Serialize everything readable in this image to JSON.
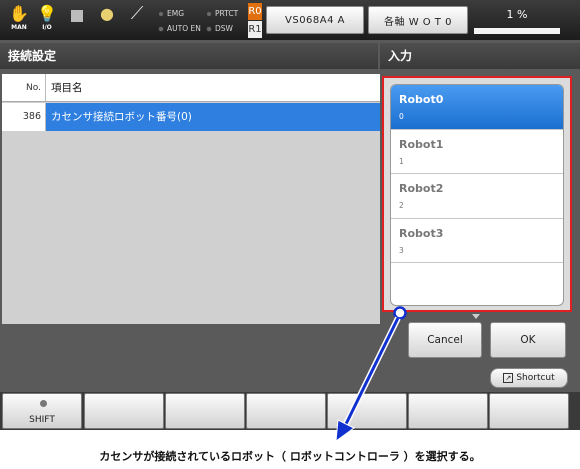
{
  "topbar": {
    "mode_caption": "MAN",
    "io_caption": "I/O",
    "leds": {
      "emg": "EMG",
      "prtct": "PRTCT",
      "auto_en": "AUTO EN",
      "dsw": "DSW"
    },
    "r0": "R0",
    "r1": "R1",
    "controller_button": "VS068A4 A",
    "axis_button": "各軸 W O T 0",
    "speed": "1 %",
    "speed_fraction": 0.01
  },
  "left_panel": {
    "title": "接続設定",
    "header": {
      "no": "No.",
      "name": "項目名"
    },
    "rows": [
      {
        "no": "386",
        "name": "カセンサ接続ロボット番号(0)"
      }
    ]
  },
  "right_panel": {
    "title": "入力",
    "options": [
      {
        "title": "Robot0",
        "value": "0",
        "selected": true
      },
      {
        "title": "Robot1",
        "value": "1",
        "selected": false
      },
      {
        "title": "Robot2",
        "value": "2",
        "selected": false
      },
      {
        "title": "Robot3",
        "value": "3",
        "selected": false
      }
    ],
    "cancel": "Cancel",
    "ok": "OK"
  },
  "shortcut": "Shortcut",
  "function_keys": {
    "f1": "SHIFT"
  },
  "caption": "カセンサが接続されているロボット（ ロボットコントローラ ）を選択する。",
  "colors": {
    "highlight": "#e02020",
    "arrow": "#1030d0",
    "selection": "#2e7fe0"
  }
}
